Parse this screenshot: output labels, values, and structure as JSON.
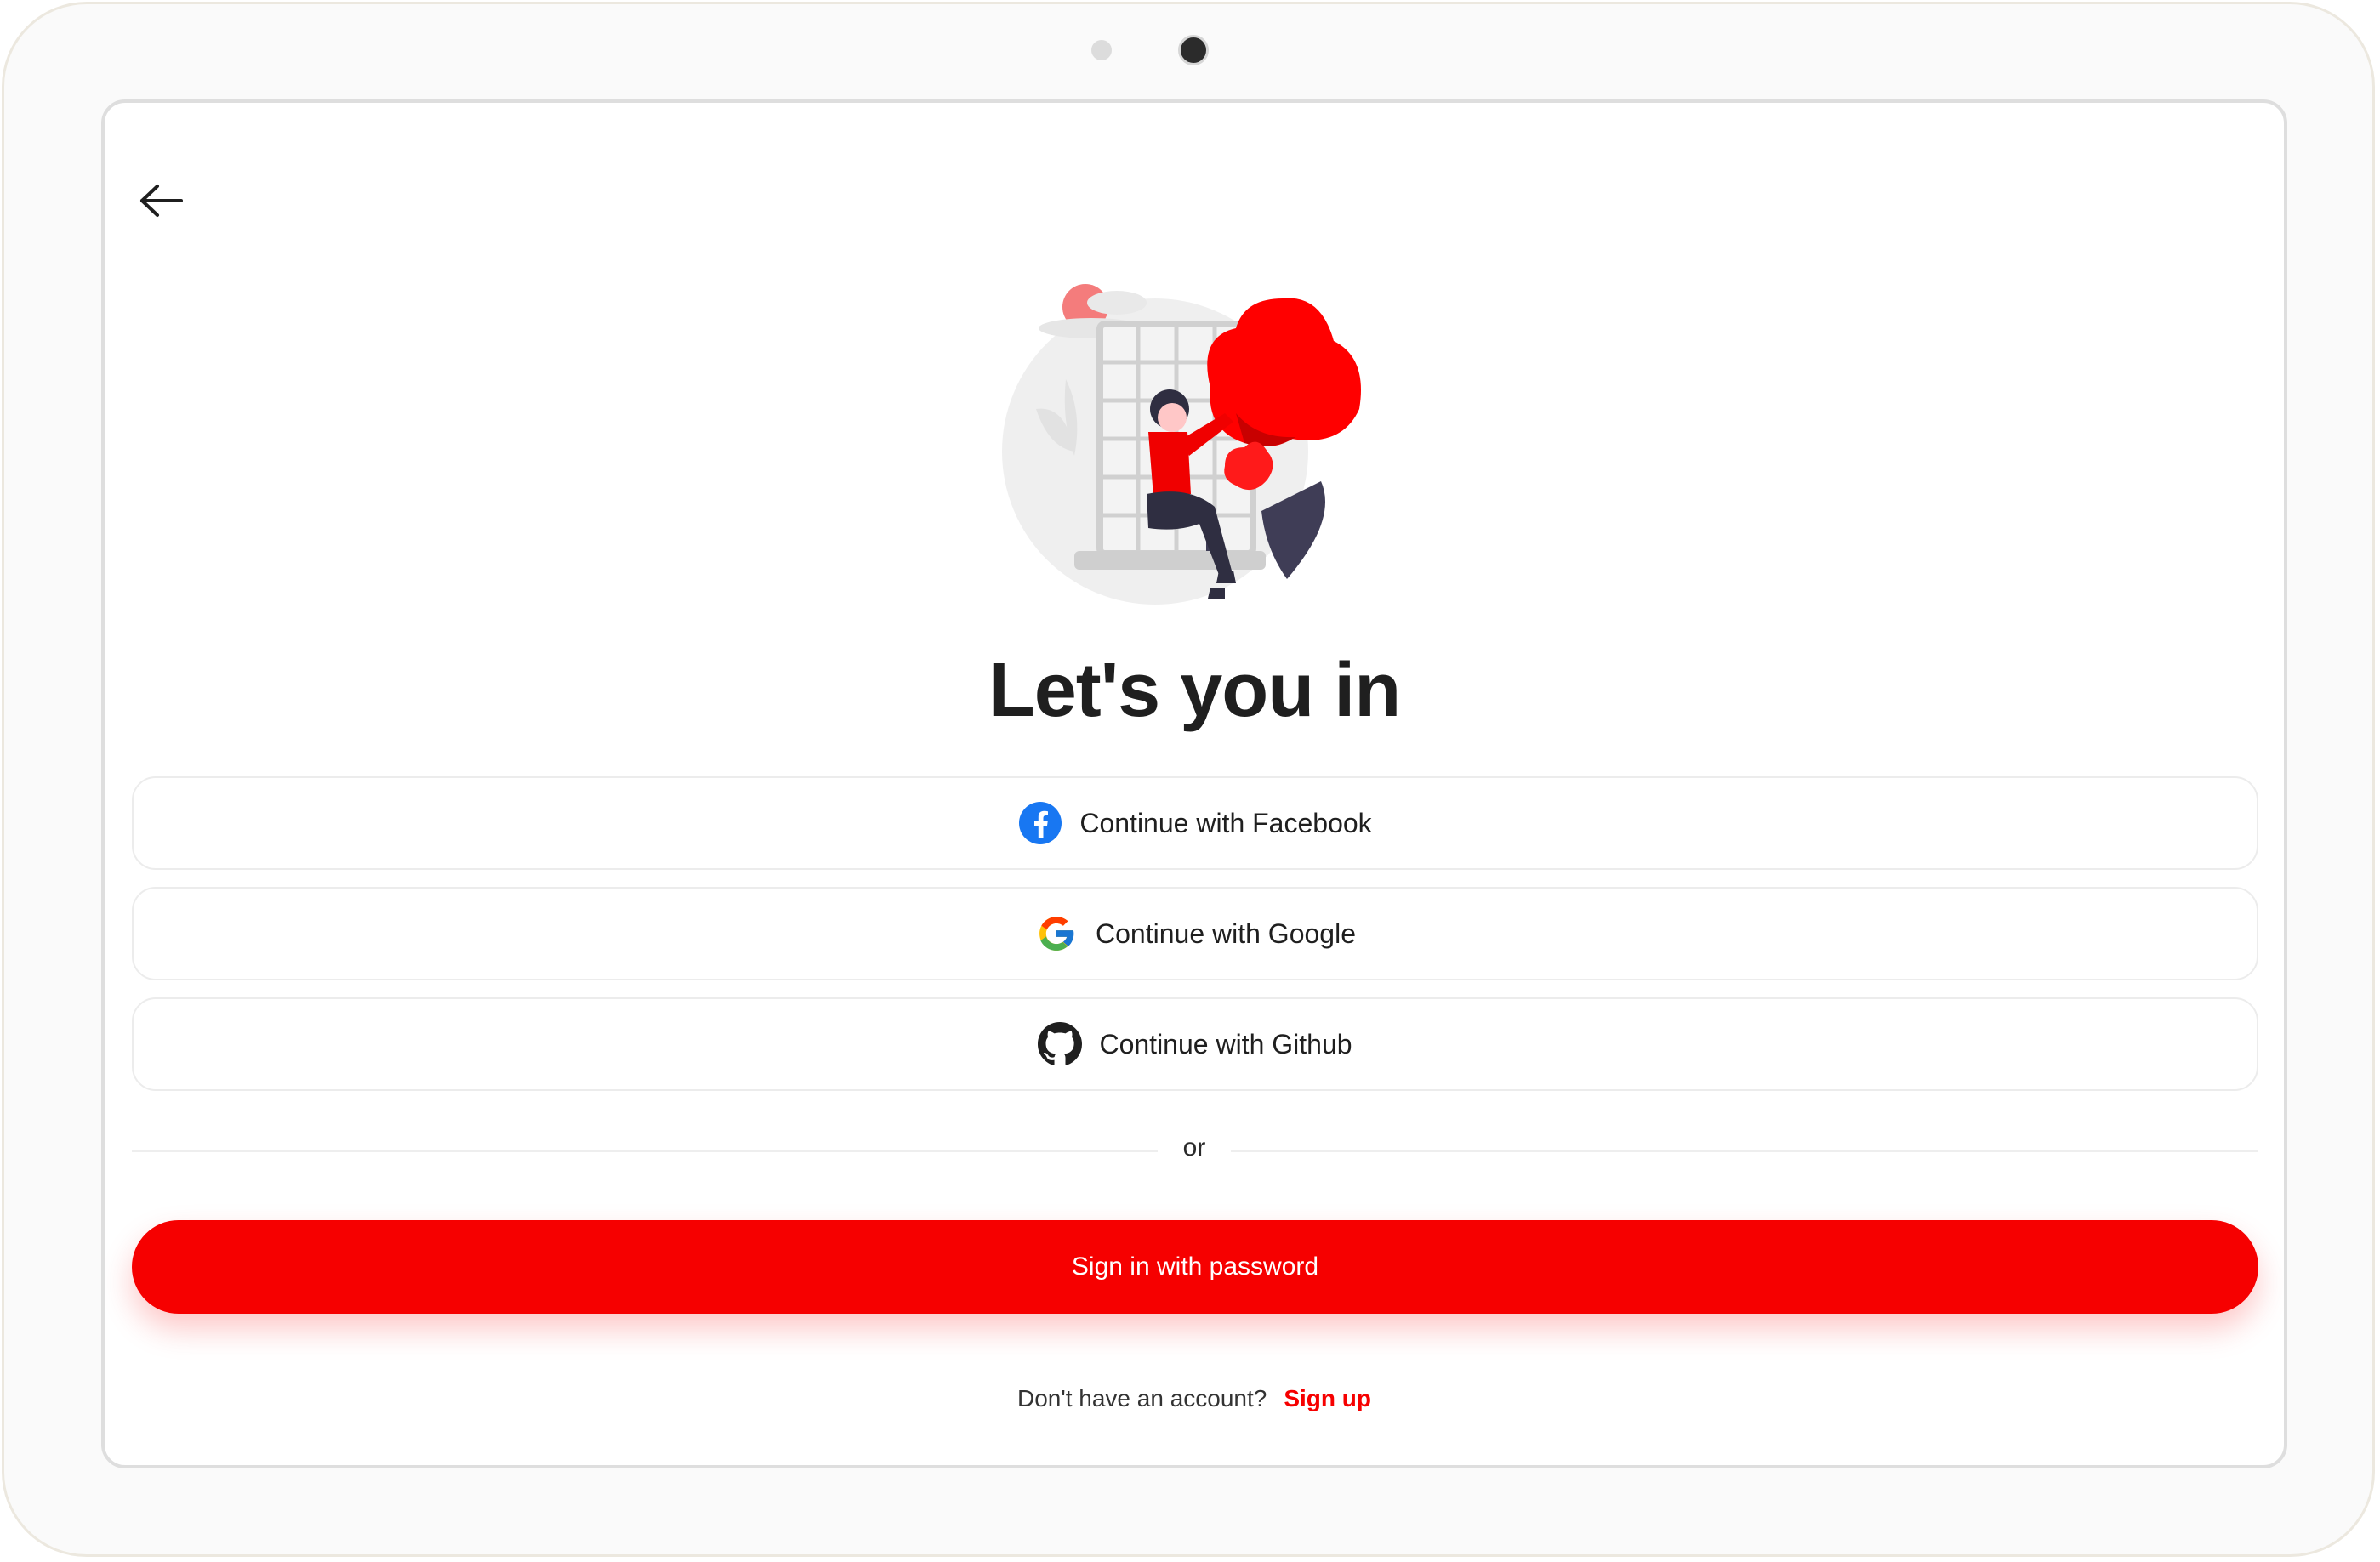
{
  "screen": {
    "title": "Let's you in"
  },
  "social_buttons": [
    {
      "label": "Continue with Facebook",
      "icon": "facebook-icon"
    },
    {
      "label": "Continue with Google",
      "icon": "google-icon"
    },
    {
      "label": "Continue with Github",
      "icon": "github-icon"
    }
  ],
  "divider": {
    "label": "or"
  },
  "primary": {
    "label": "Sign in with password"
  },
  "footer": {
    "prompt": "Don't have an account?",
    "link": "Sign up"
  },
  "colors": {
    "accent": "#f60000",
    "text": "#1f1f1f",
    "facebook": "#1877f2"
  },
  "icons": {
    "back": "arrow-left-icon",
    "illustration": "person-sitting-by-window-illustration"
  }
}
